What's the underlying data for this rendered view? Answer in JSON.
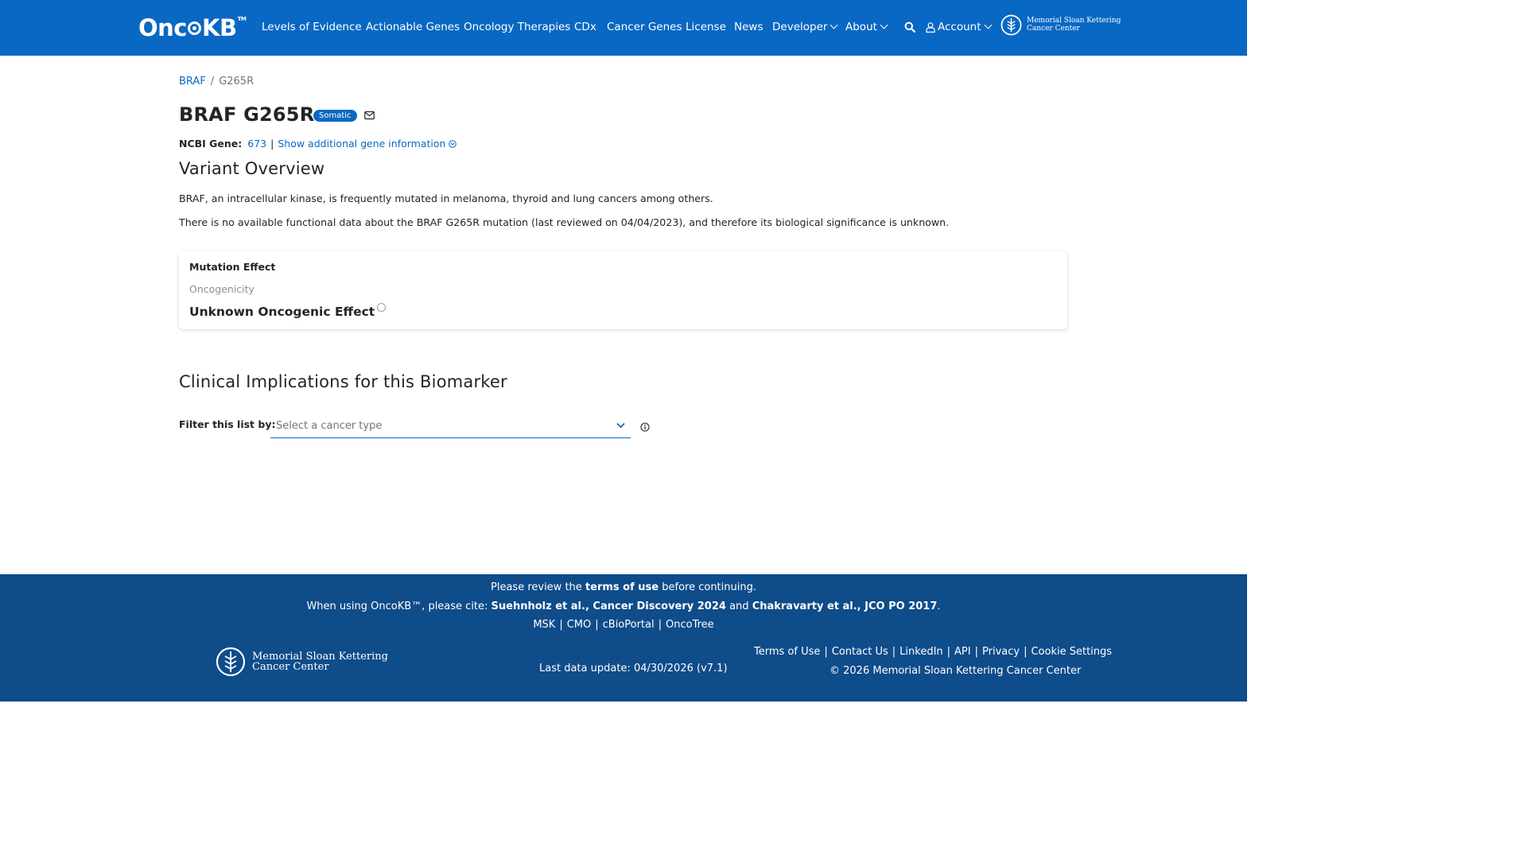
{
  "header": {
    "logo_text": "Onc",
    "logo_text_end": "KB",
    "logo_tm": "TM",
    "nav": [
      {
        "label": "Levels of Evidence"
      },
      {
        "label": "Actionable Genes"
      },
      {
        "label": "Oncology Therapies"
      },
      {
        "label": "CDx"
      },
      {
        "label": "Cancer Genes"
      },
      {
        "label": "License"
      },
      {
        "label": "News"
      },
      {
        "label": "Developer"
      },
      {
        "label": "About"
      }
    ],
    "account_label": "Account",
    "msk_line1": "Memorial Sloan Kettering",
    "msk_line2": "Cancer Center"
  },
  "breadcrumb": {
    "gene": "BRAF",
    "separator": "/",
    "current": "G265R"
  },
  "title": {
    "text": "BRAF G265R",
    "badge": "Somatic"
  },
  "gene_info": {
    "label": "NCBI Gene:",
    "id": "673",
    "pipe": "|",
    "more_link": "Show additional gene information"
  },
  "overview": {
    "heading": "Variant Overview",
    "p1": "BRAF, an intracellular kinase, is frequently mutated in melanoma, thyroid and lung cancers among others.",
    "p2": "There is no available functional data about the BRAF G265R mutation (last reviewed on 04/04/2023), and therefore its biological significance is unknown."
  },
  "mutation_card": {
    "title": "Mutation Effect",
    "sub": "Oncogenicity",
    "value": "Unknown Oncogenic Effect"
  },
  "clinical": {
    "heading": "Clinical Implications for this Biomarker",
    "filter_label": "Filter this list by:",
    "select_placeholder": "Select a cancer type"
  },
  "footer": {
    "review_pre": "Please review the ",
    "review_link": "terms of use",
    "review_post": " before continuing.",
    "cite_pre": "When using OncoKB™, please cite: ",
    "cite_1": "Suehnholz et al., Cancer Discovery 2024",
    "cite_and": " and ",
    "cite_2": "Chakravarty et al., JCO PO 2017",
    "cite_end": ".",
    "links": [
      "MSK",
      "CMO",
      "cBioPortal",
      "OncoTree"
    ],
    "msk_line1": "Memorial Sloan Kettering",
    "msk_line2": "Cancer Center",
    "last_update": "Last data update: 04/30/2026 (v7.1)",
    "right_links": [
      "Terms of Use",
      "Contact Us",
      "LinkedIn",
      "API",
      "Privacy",
      "Cookie Settings"
    ],
    "copyright": "© 2026 Memorial Sloan Kettering Cancer Center"
  },
  "colors": {
    "primary": "#0968c3",
    "footer_bg": "#0f4c8a"
  }
}
